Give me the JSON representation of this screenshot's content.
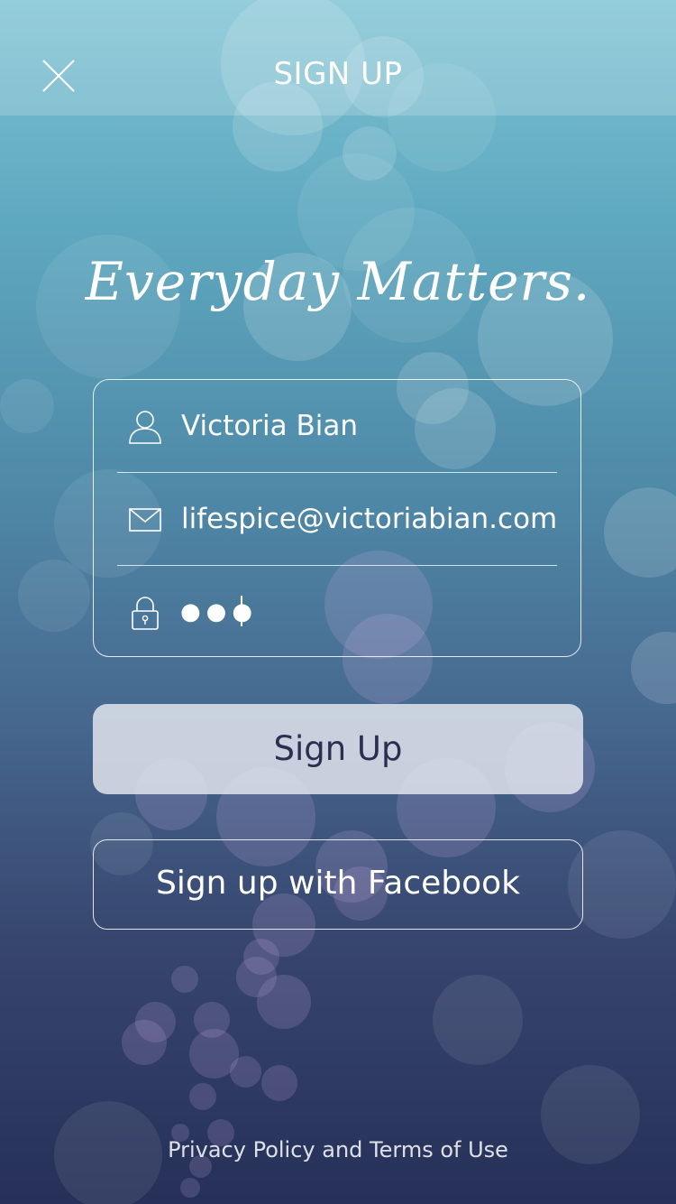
{
  "nav": {
    "title": "SIGN UP",
    "close_icon": "close-icon"
  },
  "tagline": "Everyday Matters.",
  "form": {
    "name": {
      "icon": "user-icon",
      "value": "Victoria Bian"
    },
    "email": {
      "icon": "mail-icon",
      "value": "lifespice@victoriabian.com"
    },
    "password": {
      "icon": "lock-icon",
      "masked_value": "●●●"
    }
  },
  "buttons": {
    "sign_up": "Sign Up",
    "facebook": "Sign up with Facebook"
  },
  "footer": {
    "link": "Privacy Policy and Terms of Use"
  },
  "colors": {
    "gradient_top": "#7dc2d3",
    "gradient_bottom": "#263058",
    "primary_button_text": "#2d2f52"
  }
}
